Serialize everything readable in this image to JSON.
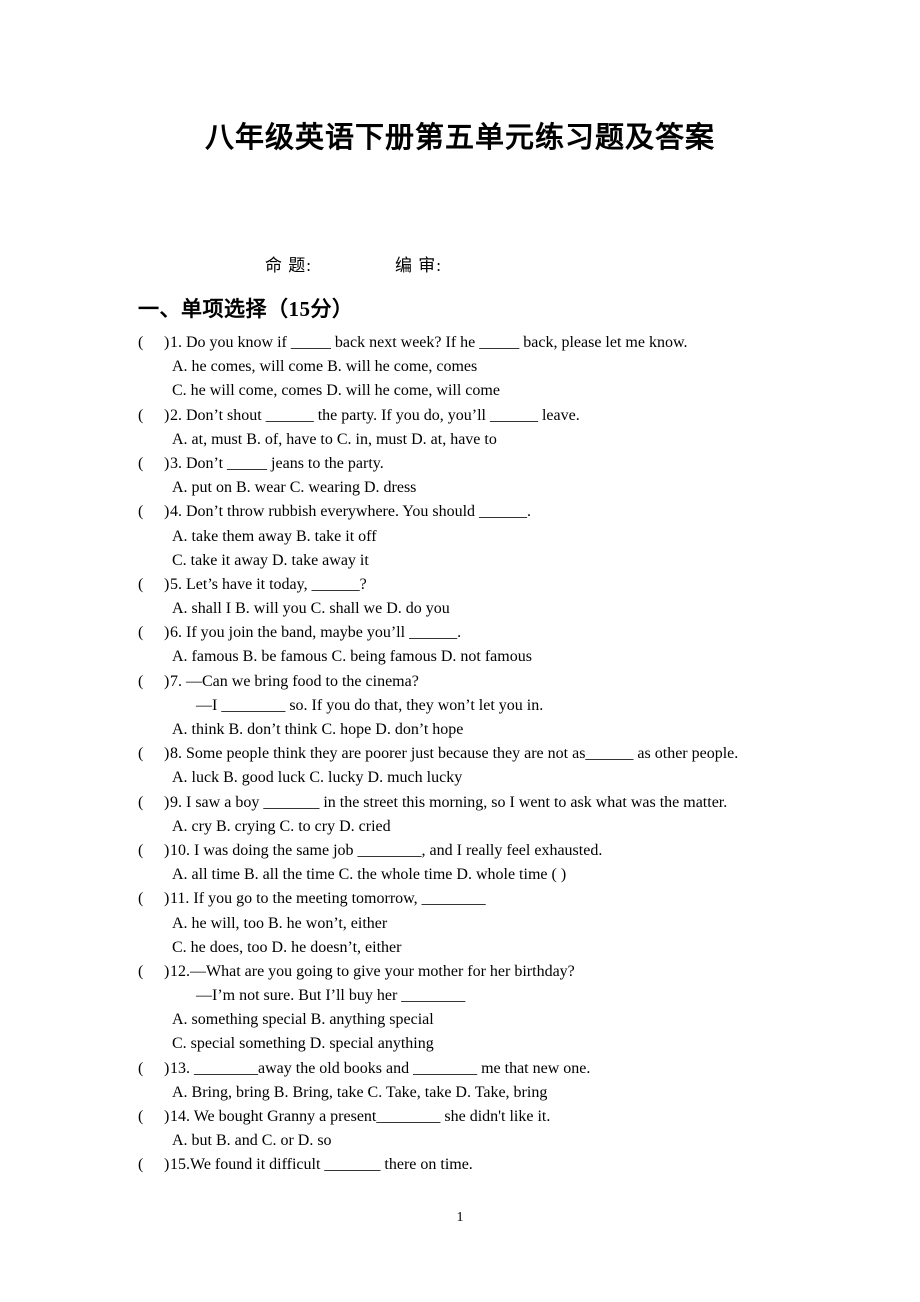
{
  "document": {
    "title": "八年级英语下册第五单元练习题及答案",
    "page_number": "1"
  },
  "byline": {
    "compose_label": "命 题:",
    "review_label": "编 审:"
  },
  "section": {
    "heading": "一、单项选择（15分）",
    "paren_open": "(",
    "paren_close": ")"
  },
  "questions": [
    {
      "stem": "1. Do you know if _____ back next week? If he _____ back, please let me know.",
      "option_lines": [
        "A. he comes, will come     B. will he come, comes",
        "C. he will come, comes     D. will he come, will come"
      ]
    },
    {
      "stem": "2. Don’t shout ______ the party. If you do, you’ll ______ leave.",
      "option_lines": [
        "A. at, must   B. of, have to        C. in, must   D. at, have to"
      ]
    },
    {
      "stem": "3. Don’t _____ jeans to the party.",
      "option_lines": [
        "A. put on   B. wear   C. wearing   D. dress"
      ]
    },
    {
      "stem": "4. Don’t throw rubbish everywhere. You should ______.",
      "option_lines": [
        "A. take them away    B. take it off",
        "C. take it away        D. take away it"
      ]
    },
    {
      "stem": "5. Let’s have it today, ______?",
      "option_lines": [
        "A. shall I        B. will you     C. shall we              D. do you"
      ]
    },
    {
      "stem": "6. If you join the band, maybe you’ll ______.",
      "option_lines": [
        "A. famous              B. be famous     C. being famous   D. not famous"
      ]
    },
    {
      "stem": "7. —Can we bring food to the cinema?",
      "continuation": "—I ________ so. If you do that, they won’t let you in.",
      "option_lines": [
        "A. think        B. don’t think     C. hope        D. don’t hope"
      ]
    },
    {
      "stem": "8. Some people think they are poorer just because they are not as______ as other people.",
      "option_lines": [
        "A. luck        B. good luck     C. lucky        D. much lucky"
      ]
    },
    {
      "stem": "9. I saw a boy _______ in the street this morning, so I went to ask what was the matter.",
      "option_lines": [
        "A. cry      B. crying      C. to cry      D. cried"
      ]
    },
    {
      "stem": "10. I was doing the same job ________, and I really feel exhausted.",
      "option_lines": [
        "A. all time              B. all the time     C. the whole time   D. whole time (      )"
      ]
    },
    {
      "stem": "11. If you go to the meeting tomorrow, ________",
      "option_lines": [
        "A. he will, too        B. he won’t, either",
        "C. he does, too       D. he doesn’t, either"
      ]
    },
    {
      "stem": " 12.—What are you going to give your mother for her birthday?",
      "continuation": "—I’m not sure. But I’ll buy her ________",
      "option_lines": [
        "A. something special     B. anything special",
        "C. special something     D. special anything"
      ]
    },
    {
      "stem": " 13. ________away the old books and  ________ me that new one.",
      "option_lines": [
        "A. Bring, bring        B. Bring, take C. Take, take  D. Take, bring"
      ]
    },
    {
      "stem": " 14. We bought Granny a present________ she didn't like it.",
      "option_lines": [
        "A. but     B. and     C. or       D. so"
      ]
    },
    {
      "stem": " 15.We found it difficult _______ there on time.",
      "option_lines": []
    }
  ]
}
